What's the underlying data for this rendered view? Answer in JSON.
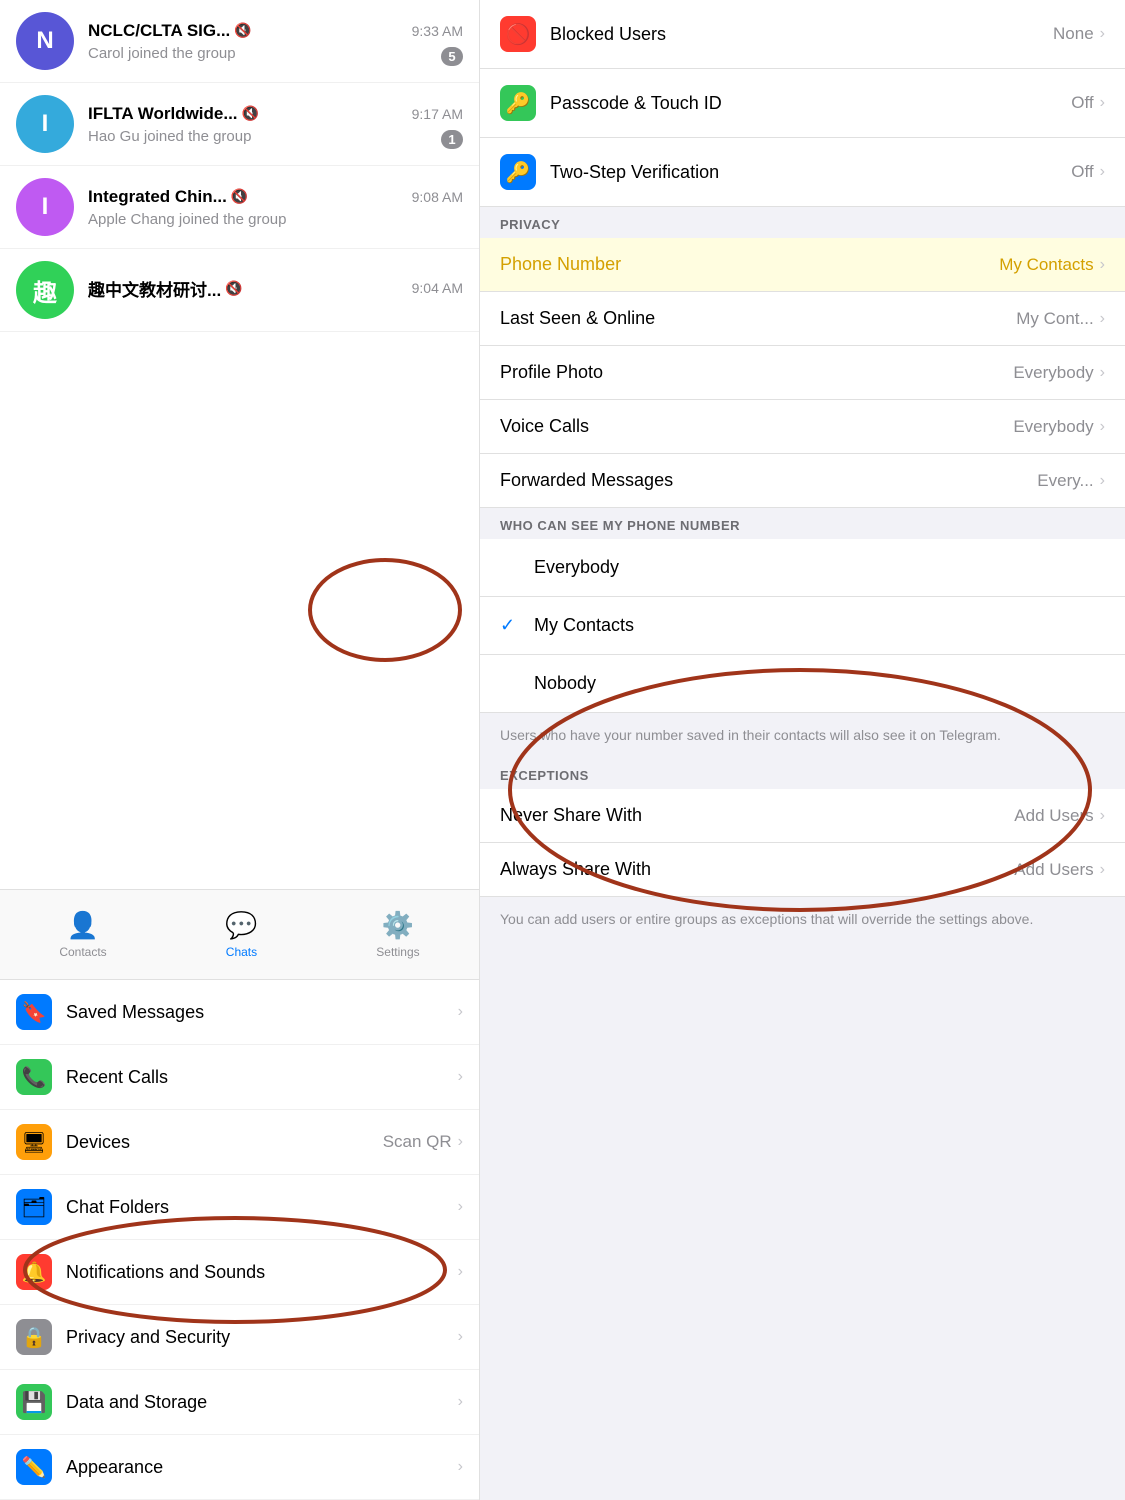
{
  "left": {
    "chats": [
      {
        "id": "nclc",
        "initial": "N",
        "avatarColor": "#5856d6",
        "name": "NCLC/CLTA SIG...",
        "muted": true,
        "time": "9:33 AM",
        "preview": "Carol joined the group",
        "badge": "5"
      },
      {
        "id": "iflta",
        "initial": "I",
        "avatarColor": "#34aadc",
        "name": "IFLTA Worldwide...",
        "muted": true,
        "time": "9:17 AM",
        "preview": "Hao Gu joined the group",
        "badge": "1"
      },
      {
        "id": "integrated",
        "initial": "I",
        "avatarColor": "#bf5af2",
        "name": "Integrated Chin...",
        "muted": true,
        "time": "9:08 AM",
        "preview": "Apple Chang joined the group",
        "badge": ""
      },
      {
        "id": "zhongwen",
        "initial": "趣",
        "avatarColor": "#30d158",
        "name": "趣中文教材研讨...",
        "muted": true,
        "time": "9:04 AM",
        "preview": "",
        "badge": ""
      }
    ],
    "tabs": [
      {
        "id": "contacts",
        "label": "Contacts",
        "icon": "👤",
        "active": false
      },
      {
        "id": "chats",
        "label": "Chats",
        "icon": "💬",
        "active": true
      },
      {
        "id": "settings",
        "label": "Settings",
        "icon": "⚙️",
        "active": false
      }
    ],
    "settings": [
      {
        "id": "saved",
        "label": "Saved Messages",
        "icon": "🔖",
        "iconBg": "#007aff",
        "value": "",
        "chevron": true
      },
      {
        "id": "calls",
        "label": "Recent Calls",
        "icon": "📞",
        "iconBg": "#34c759",
        "value": "",
        "chevron": true
      },
      {
        "id": "devices",
        "label": "Devices",
        "icon": "🖥",
        "iconBg": "#ff9f0a",
        "value": "Scan QR",
        "chevron": true
      },
      {
        "id": "folders",
        "label": "Chat Folders",
        "icon": "🗂",
        "iconBg": "#007aff",
        "value": "",
        "chevron": true
      },
      {
        "id": "notifications",
        "label": "Notifications and Sounds",
        "icon": "🔔",
        "iconBg": "#ff3b30",
        "value": "",
        "chevron": true
      },
      {
        "id": "privacy",
        "label": "Privacy and Security",
        "icon": "🔒",
        "iconBg": "#8e8e93",
        "value": "",
        "chevron": true
      },
      {
        "id": "storage",
        "label": "Data and Storage",
        "icon": "💾",
        "iconBg": "#34c759",
        "value": "",
        "chevron": true
      },
      {
        "id": "appearance",
        "label": "Appearance",
        "icon": "✏️",
        "iconBg": "#007aff",
        "value": "",
        "chevron": true
      }
    ]
  },
  "right": {
    "security_items": [
      {
        "id": "blocked",
        "label": "Blocked Users",
        "icon": "🚫",
        "iconBg": "#ff3b30",
        "value": "None",
        "chevron": true
      },
      {
        "id": "passcode",
        "label": "Passcode & Touch ID",
        "icon": "🔑",
        "iconBg": "#34c759",
        "value": "Off",
        "chevron": true
      },
      {
        "id": "twostep",
        "label": "Two-Step Verification",
        "icon": "🔑",
        "iconBg": "#007aff",
        "value": "Off",
        "chevron": true
      }
    ],
    "privacy_section_label": "PRIVACY",
    "privacy_items": [
      {
        "id": "phone",
        "label": "Phone Number",
        "value": "My Contacts",
        "chevron": true,
        "highlighted": true
      },
      {
        "id": "lastseen",
        "label": "Last Seen & Online",
        "value": "My Cont...",
        "chevron": true,
        "highlighted": false
      },
      {
        "id": "profilephoto",
        "label": "Profile Photo",
        "value": "Everybody",
        "chevron": true,
        "highlighted": false
      },
      {
        "id": "voicecalls",
        "label": "Voice Calls",
        "value": "Everybody",
        "chevron": true,
        "highlighted": false
      },
      {
        "id": "forwarded",
        "label": "Forwarded Messages",
        "value": "Every...",
        "chevron": true,
        "highlighted": false
      }
    ],
    "who_can_see_label": "WHO CAN SEE MY PHONE NUMBER",
    "phone_options": [
      {
        "id": "everybody",
        "label": "Everybody",
        "checked": false
      },
      {
        "id": "mycontacts",
        "label": "My Contacts",
        "checked": true
      },
      {
        "id": "nobody",
        "label": "Nobody",
        "checked": false
      }
    ],
    "phone_note": "Users who have your number saved in their contacts will also see it on Telegram.",
    "exceptions_label": "EXCEPTIONS",
    "exceptions_items": [
      {
        "id": "nevershare",
        "label": "Never Share With",
        "value": "Add Users",
        "chevron": true
      },
      {
        "id": "alwaysshare",
        "label": "Always Share With",
        "value": "Add Users",
        "chevron": true
      }
    ],
    "exceptions_note": "You can add users or entire groups as exceptions that will override the settings above."
  }
}
